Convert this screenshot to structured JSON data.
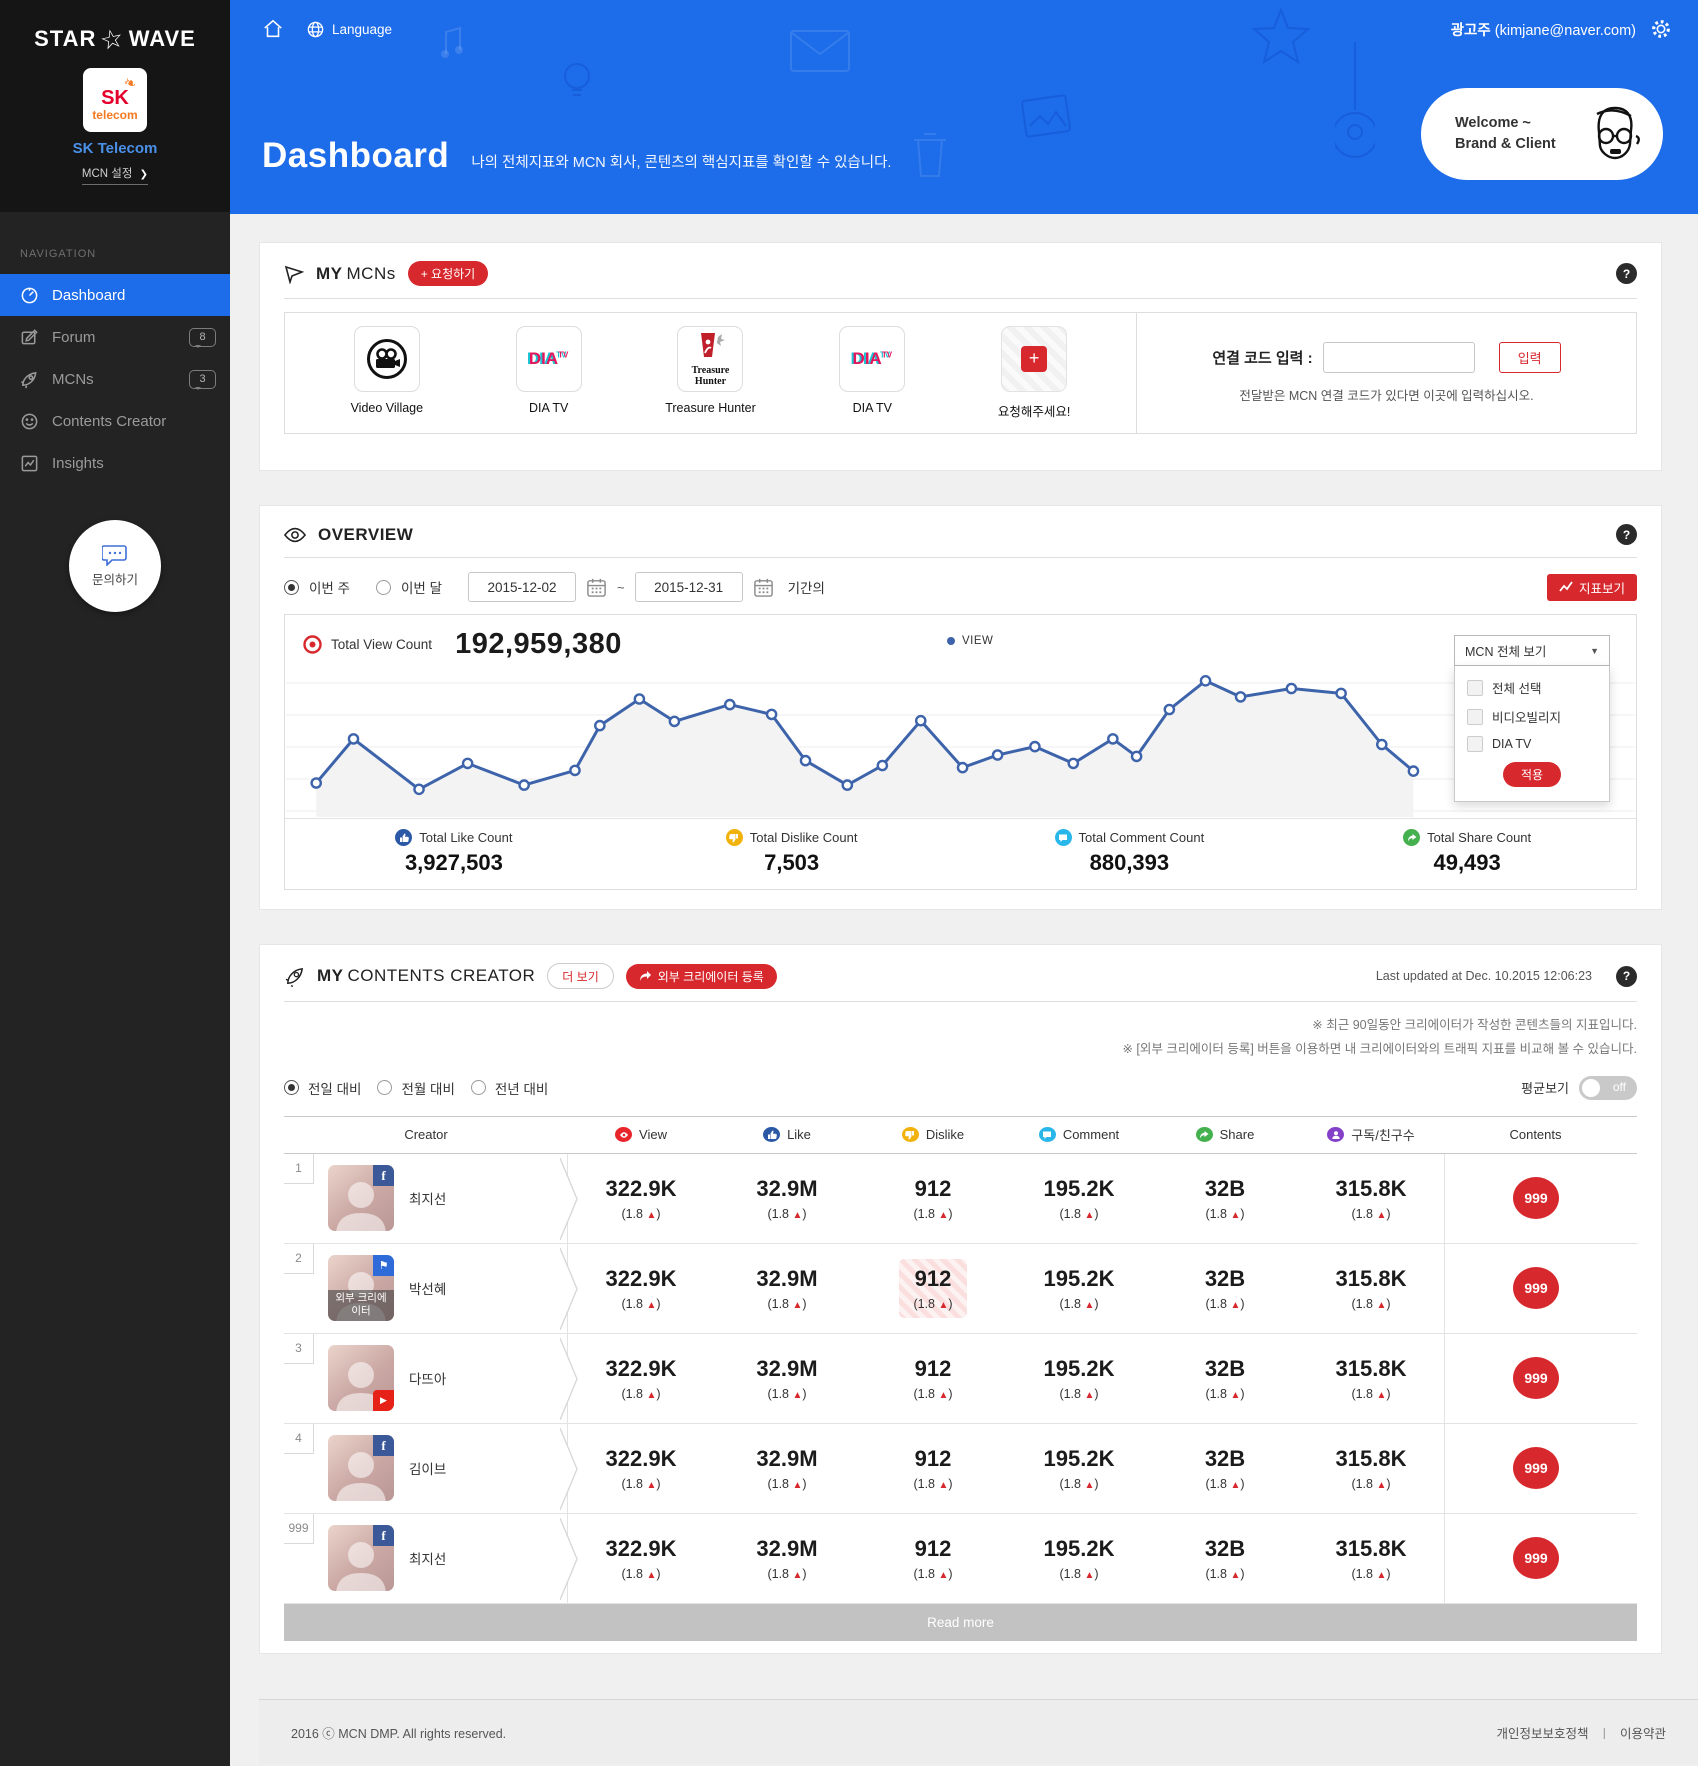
{
  "sidebar": {
    "logo": {
      "part1": "STAR",
      "part2": "WAVE"
    },
    "client": {
      "tile_top": "SK",
      "tile_bottom": "telecom",
      "name": "SK Telecom",
      "settings": "MCN 설정"
    },
    "nav_heading": "NAVIGATION",
    "items": [
      {
        "label": "Dashboard",
        "icon": "dashboard",
        "active": true,
        "badge": null
      },
      {
        "label": "Forum",
        "icon": "forum",
        "active": false,
        "badge": "8"
      },
      {
        "label": "MCNs",
        "icon": "rocket",
        "active": false,
        "badge": "3"
      },
      {
        "label": "Contents Creator",
        "icon": "smiley",
        "active": false,
        "badge": null
      },
      {
        "label": "Insights",
        "icon": "insights",
        "active": false,
        "badge": null
      }
    ],
    "contact": "문의하기"
  },
  "header": {
    "language": "Language",
    "user_role": "광고주",
    "user_email": "(kimjane@naver.com)",
    "welcome_line1": "Welcome ~",
    "welcome_line2": "Brand & Client",
    "title": "Dashboard",
    "subtitle": "나의 전체지표와 MCN 회사, 콘텐츠의 핵심지표를 확인할 수 있습니다."
  },
  "my_mcns": {
    "title_bold": "MY",
    "title_rest": "MCNs",
    "request_button": "+ 요청하기",
    "tiles": [
      {
        "name": "Video Village"
      },
      {
        "name": "DIA TV",
        "logo_text": "DIA",
        "logo_sup": "TV"
      },
      {
        "name": "Treasure Hunter",
        "logo_line1": "Treasure",
        "logo_line2": "Hunter"
      },
      {
        "name": "DIA TV",
        "logo_text": "DIA",
        "logo_sup": "TV"
      },
      {
        "name": "요청해주세요!"
      }
    ],
    "code_label": "연결 코드 입력 :",
    "code_button": "입력",
    "code_help": "전달받은 MCN 연결 코드가 있다면 이곳에 입력하십시오."
  },
  "overview": {
    "title": "OVERVIEW",
    "periods": [
      {
        "label": "이번 주",
        "selected": true
      },
      {
        "label": "이번 달",
        "selected": false
      }
    ],
    "date_from": "2015-12-02",
    "date_tilde": "~",
    "date_to": "2015-12-31",
    "date_suffix": "기간의",
    "metrics_button": "지표보기",
    "total_view_label": "Total View Count",
    "total_view_value": "192,959,380",
    "legend": "VIEW",
    "filter": {
      "button": "MCN 전체 보기",
      "options": [
        "전체 선택",
        "비디오빌리지",
        "DIA TV"
      ],
      "apply": "적용"
    },
    "chart_data": {
      "type": "line",
      "title": "Total View Count trend",
      "legend_entries": [
        "VIEW"
      ],
      "x_range_label": "2015-12-02 ~ 2015-12-31",
      "grid": true,
      "series": [
        {
          "name": "VIEW",
          "points": [
            [
              17,
              160
            ],
            [
              50,
              97
            ],
            [
              108,
              169
            ],
            [
              151,
              132
            ],
            [
              201,
              163
            ],
            [
              246,
              142
            ],
            [
              268,
              78
            ],
            [
              303,
              40
            ],
            [
              334,
              72
            ],
            [
              383,
              48
            ],
            [
              420,
              62
            ],
            [
              450,
              128
            ],
            [
              487,
              163
            ],
            [
              518,
              135
            ],
            [
              552,
              71
            ],
            [
              589,
              138
            ],
            [
              620,
              120
            ],
            [
              653,
              108
            ],
            [
              687,
              132
            ],
            [
              722,
              97
            ],
            [
              743,
              122
            ],
            [
              772,
              55
            ],
            [
              804,
              14
            ],
            [
              835,
              37
            ],
            [
              880,
              25
            ],
            [
              924,
              32
            ],
            [
              960,
              105
            ],
            [
              988,
              143
            ]
          ]
        }
      ],
      "note": "points normalized: x 0-1000 left-to-right, y 0-200 top-down"
    },
    "totals": [
      {
        "label": "Total Like Count",
        "value": "3,927,503",
        "icon": "like",
        "color": "#2b59a6"
      },
      {
        "label": "Total Dislike Count",
        "value": "7,503",
        "icon": "dislike",
        "color": "#f2b20c"
      },
      {
        "label": "Total Comment Count",
        "value": "880,393",
        "icon": "comment",
        "color": "#29b7ea"
      },
      {
        "label": "Total Share Count",
        "value": "49,493",
        "icon": "share",
        "color": "#45b04e"
      }
    ]
  },
  "creators": {
    "title_bold": "MY",
    "title_rest": "CONTENTS CREATOR",
    "more_button": "더 보기",
    "register_button": "외부 크리에이터 등록",
    "last_updated": "Last updated at Dec. 10.2015 12:06:23",
    "notes": [
      "※ 최근 90일동안 크리에이터가 작성한 콘텐츠들의 지표입니다.",
      "※ [외부 크리에이터 등록] 버튼을 이용하면 내 크리에이터와의 트래픽 지표를 비교해 볼 수 있습니다."
    ],
    "compare": [
      {
        "label": "전일 대비",
        "selected": true
      },
      {
        "label": "전월 대비",
        "selected": false
      },
      {
        "label": "전년 대비",
        "selected": false
      }
    ],
    "avg_label": "평균보기",
    "avg_state": "off",
    "table": {
      "headers": [
        {
          "label": "Creator",
          "icon": null,
          "color": null
        },
        {
          "label": "View",
          "icon": "view",
          "color": "#e8252b"
        },
        {
          "label": "Like",
          "icon": "like",
          "color": "#2b59a6"
        },
        {
          "label": "Dislike",
          "icon": "dislike",
          "color": "#f2b20c"
        },
        {
          "label": "Comment",
          "icon": "comment",
          "color": "#29b7ea"
        },
        {
          "label": "Share",
          "icon": "share",
          "color": "#45b04e"
        },
        {
          "label": "구독/친구수",
          "icon": "subs",
          "color": "#8440c8"
        },
        {
          "label": "Contents",
          "icon": null,
          "color": null
        }
      ],
      "delta": {
        "prefix": "(1.8 ",
        "arrow": "▲",
        "suffix": ")"
      },
      "rows": [
        {
          "rank": "1",
          "name": "최지선",
          "badge": "facebook",
          "overlay": null,
          "highlight_col": null,
          "values": [
            "322.9K",
            "32.9M",
            "912",
            "195.2K",
            "32B",
            "315.8K"
          ],
          "contents": "999"
        },
        {
          "rank": "2",
          "name": "박선혜",
          "badge": "flag",
          "overlay": "외부 크리에이터",
          "highlight_col": 2,
          "values": [
            "322.9K",
            "32.9M",
            "912",
            "195.2K",
            "32B",
            "315.8K"
          ],
          "contents": "999"
        },
        {
          "rank": "3",
          "name": "다뜨아",
          "badge": "youtube",
          "overlay": null,
          "highlight_col": null,
          "values": [
            "322.9K",
            "32.9M",
            "912",
            "195.2K",
            "32B",
            "315.8K"
          ],
          "contents": "999"
        },
        {
          "rank": "4",
          "name": "김이브",
          "badge": "facebook",
          "overlay": null,
          "highlight_col": null,
          "values": [
            "322.9K",
            "32.9M",
            "912",
            "195.2K",
            "32B",
            "315.8K"
          ],
          "contents": "999"
        },
        {
          "rank": "999",
          "name": "최지선",
          "badge": "facebook",
          "overlay": null,
          "highlight_col": null,
          "values": [
            "322.9K",
            "32.9M",
            "912",
            "195.2K",
            "32B",
            "315.8K"
          ],
          "contents": "999"
        }
      ]
    },
    "read_more": "Read more"
  },
  "footer": {
    "copyright": "2016 ⓒ MCN DMP. All rights reserved.",
    "links": [
      "개인정보보호정책",
      "이용약관"
    ],
    "divider": "ㅣ"
  }
}
